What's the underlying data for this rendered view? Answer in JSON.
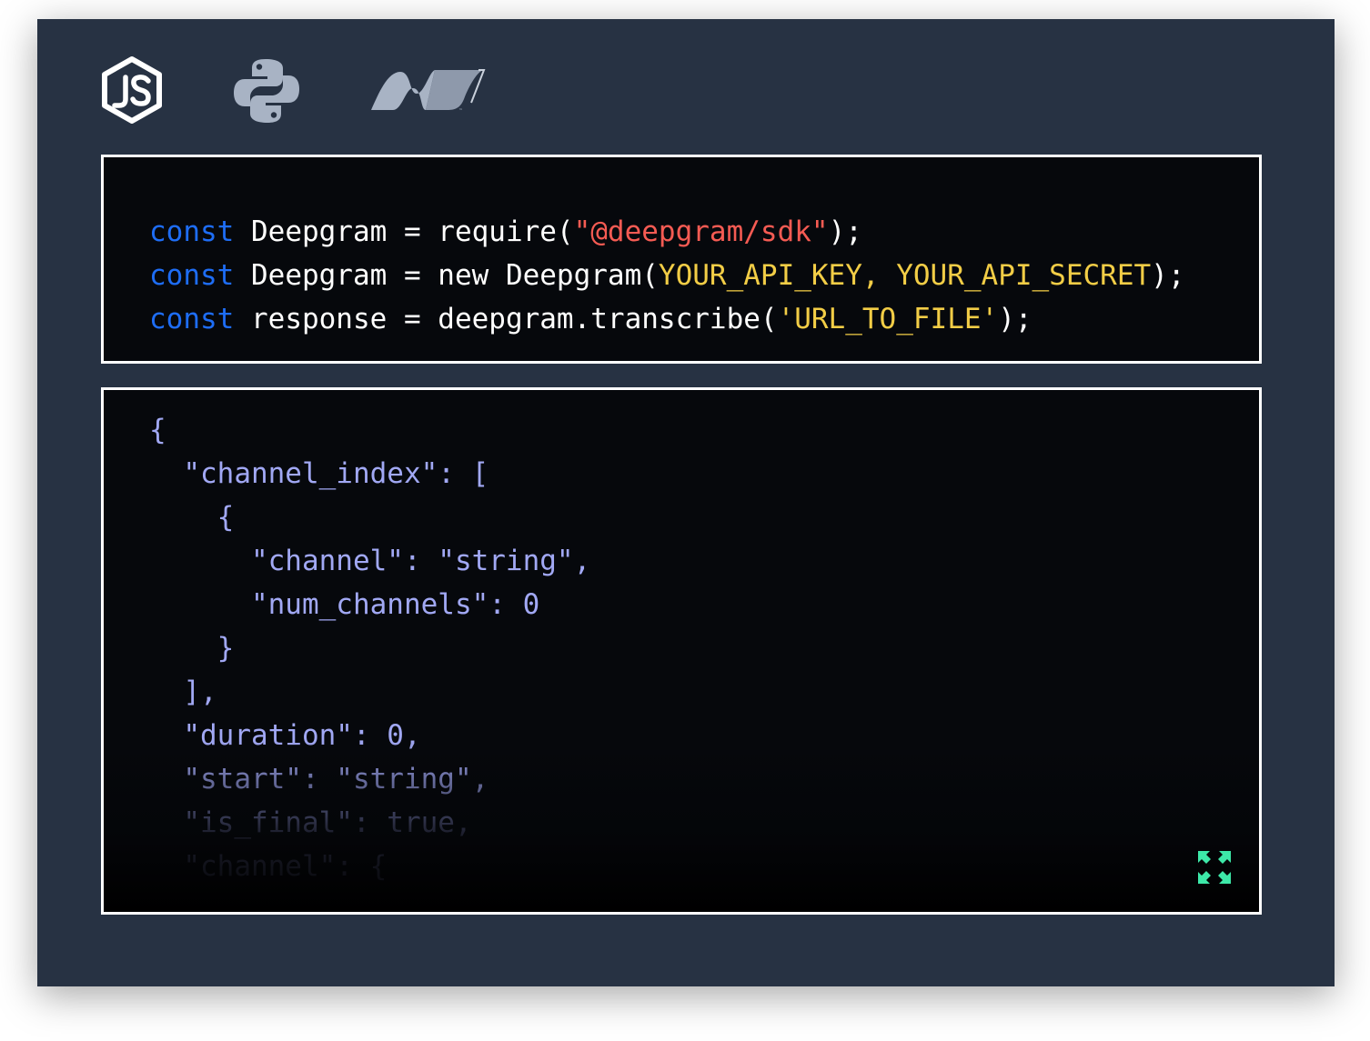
{
  "languages": [
    {
      "name": "nodejs-icon"
    },
    {
      "name": "python-icon"
    },
    {
      "name": "dotnet-icon"
    }
  ],
  "code_sample": {
    "lines": [
      [
        {
          "t": "const",
          "c": "kw"
        },
        {
          "t": " Deepgram = require(",
          "c": "plain"
        },
        {
          "t": "\"@deepgram/sdk\"",
          "c": "str-red"
        },
        {
          "t": ");",
          "c": "plain"
        }
      ],
      [
        {
          "t": "const",
          "c": "kw"
        },
        {
          "t": " Deepgram = new Deepgram(",
          "c": "plain"
        },
        {
          "t": "YOUR_API_KEY, YOUR_API_SECRET",
          "c": "str-yel"
        },
        {
          "t": ");",
          "c": "plain"
        }
      ],
      [
        {
          "t": "const",
          "c": "kw"
        },
        {
          "t": " response = deepgram.transcribe(",
          "c": "plain"
        },
        {
          "t": "'URL_TO_FILE'",
          "c": "str-yel"
        },
        {
          "t": ");",
          "c": "plain"
        }
      ]
    ]
  },
  "response_sample": {
    "lines": [
      "{",
      "  \"channel_index\": [",
      "    {",
      "      \"channel\": \"string\",",
      "      \"num_channels\": 0",
      "    }",
      "  ],",
      "  \"duration\": 0,",
      "  \"start\": \"string\",",
      "  \"is_final\": true,",
      "  \"channel\": {"
    ]
  },
  "colors": {
    "background": "#273243",
    "code_bg": "#06080c",
    "keyword": "#1e6df5",
    "string_red": "#f55b53",
    "string_yellow": "#f2cd46",
    "json_text": "#a1a8f4",
    "expand_icon": "#3de8a8"
  },
  "expand_icon": "expand-arrows-icon"
}
